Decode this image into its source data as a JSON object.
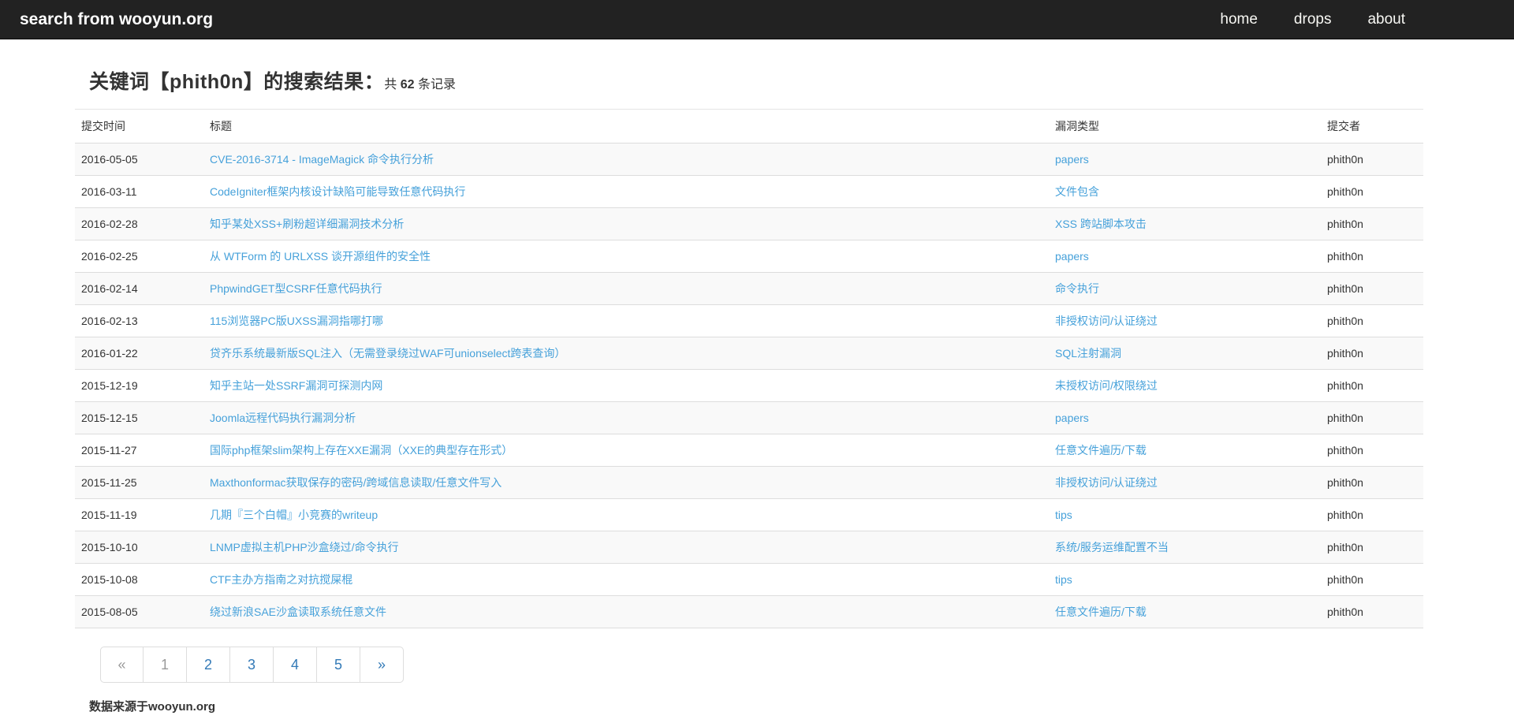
{
  "navbar": {
    "brand": "search from wooyun.org",
    "links": [
      {
        "label": "home"
      },
      {
        "label": "drops"
      },
      {
        "label": "about"
      }
    ]
  },
  "heading": {
    "main": "关键词【phith0n】的搜索结果：",
    "count_prefix": "共 ",
    "count": "62",
    "count_suffix": " 条记录"
  },
  "table": {
    "columns": [
      "提交时间",
      "标题",
      "漏洞类型",
      "提交者"
    ],
    "rows": [
      {
        "date": "2016-05-05",
        "title": "CVE-2016-3714 - ImageMagick 命令执行分析",
        "type": "papers",
        "author": "phith0n"
      },
      {
        "date": "2016-03-11",
        "title": "CodeIgniter框架内核设计缺陷可能导致任意代码执行",
        "type": "文件包含",
        "author": "phith0n"
      },
      {
        "date": "2016-02-28",
        "title": "知乎某处XSS+刷粉超详细漏洞技术分析",
        "type": "XSS 跨站脚本攻击",
        "author": "phith0n"
      },
      {
        "date": "2016-02-25",
        "title": "从 WTForm 的 URLXSS 谈开源组件的安全性",
        "type": "papers",
        "author": "phith0n"
      },
      {
        "date": "2016-02-14",
        "title": "PhpwindGET型CSRF任意代码执行",
        "type": "命令执行",
        "author": "phith0n"
      },
      {
        "date": "2016-02-13",
        "title": "115浏览器PC版UXSS漏洞指哪打哪",
        "type": "非授权访问/认证绕过",
        "author": "phith0n"
      },
      {
        "date": "2016-01-22",
        "title": "贷齐乐系统最新版SQL注入（无需登录绕过WAF可unionselect跨表查询）",
        "type": "SQL注射漏洞",
        "author": "phith0n"
      },
      {
        "date": "2015-12-19",
        "title": "知乎主站一处SSRF漏洞可探测内网",
        "type": "未授权访问/权限绕过",
        "author": "phith0n"
      },
      {
        "date": "2015-12-15",
        "title": "Joomla远程代码执行漏洞分析",
        "type": "papers",
        "author": "phith0n"
      },
      {
        "date": "2015-11-27",
        "title": "国际php框架slim架构上存在XXE漏洞（XXE的典型存在形式）",
        "type": "任意文件遍历/下载",
        "author": "phith0n"
      },
      {
        "date": "2015-11-25",
        "title": "Maxthonformac获取保存的密码/跨域信息读取/任意文件写入",
        "type": "非授权访问/认证绕过",
        "author": "phith0n"
      },
      {
        "date": "2015-11-19",
        "title": "几期『三个白帽』小竞赛的writeup",
        "type": "tips",
        "author": "phith0n"
      },
      {
        "date": "2015-10-10",
        "title": "LNMP虚拟主机PHP沙盒绕过/命令执行",
        "type": "系统/服务运维配置不当",
        "author": "phith0n"
      },
      {
        "date": "2015-10-08",
        "title": "CTF主办方指南之对抗搅屎棍",
        "type": "tips",
        "author": "phith0n"
      },
      {
        "date": "2015-08-05",
        "title": "绕过新浪SAE沙盒读取系统任意文件",
        "type": "任意文件遍历/下载",
        "author": "phith0n"
      }
    ]
  },
  "pagination": {
    "items": [
      {
        "label": "«",
        "kind": "disabled"
      },
      {
        "label": "1",
        "kind": "disabled"
      },
      {
        "label": "2",
        "kind": "link"
      },
      {
        "label": "3",
        "kind": "link"
      },
      {
        "label": "4",
        "kind": "link"
      },
      {
        "label": "5",
        "kind": "link"
      },
      {
        "label": "»",
        "kind": "link"
      }
    ]
  },
  "footer": {
    "source_note": "数据来源于wooyun.org"
  },
  "colors": {
    "navbar_bg": "#222222",
    "navbar_text": "#ffffff",
    "link_blue": "#46a1da",
    "pagination_blue": "#337ab7",
    "pagination_disabled": "#999999",
    "row_stripe": "#f9f9f9",
    "border": "#dddddd",
    "text": "#333333"
  }
}
